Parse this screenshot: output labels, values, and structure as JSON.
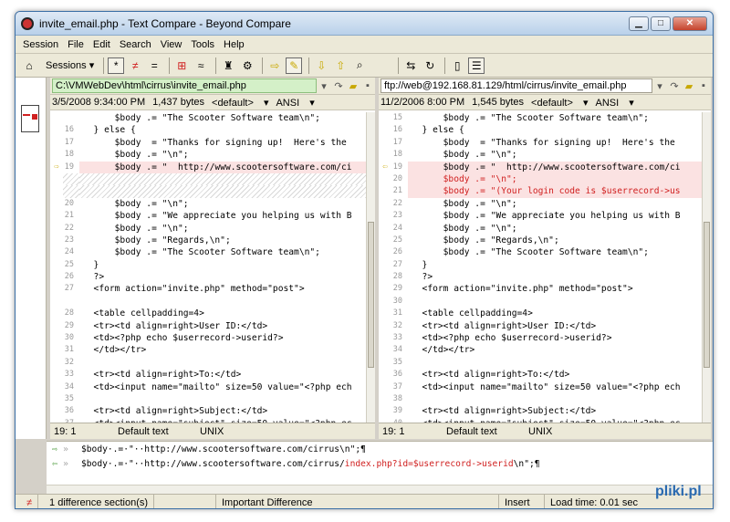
{
  "window": {
    "title": "invite_email.php - Text Compare - Beyond Compare"
  },
  "menu": [
    "Session",
    "File",
    "Edit",
    "Search",
    "View",
    "Tools",
    "Help"
  ],
  "toolbar": {
    "sessions_label": "Sessions"
  },
  "left": {
    "path": "C:\\VMWebDev\\html\\cirrus\\invite_email.php",
    "date": "3/5/2008 9:34:00 PM",
    "size": "1,437 bytes",
    "format": "<default>",
    "encoding": "ANSI",
    "position": "19: 1",
    "text_mode": "Default text",
    "line_end": "UNIX",
    "lines": [
      {
        "n": "",
        "t": "      $body .= \"The Scooter Software team\\n\";"
      },
      {
        "n": "16",
        "t": "  } else {"
      },
      {
        "n": "17",
        "t": "      $body  = \"Thanks for signing up!  Here's the"
      },
      {
        "n": "18",
        "t": "      $body .= \"\\n\";"
      },
      {
        "n": "19",
        "t": "      $body .= \"  http://www.scootersoftware.com/ci",
        "k": "diff",
        "m": "⇨"
      },
      {
        "n": "",
        "t": "",
        "k": "hatch"
      },
      {
        "n": "",
        "t": "",
        "k": "hatch"
      },
      {
        "n": "20",
        "t": "      $body .= \"\\n\";"
      },
      {
        "n": "21",
        "t": "      $body .= \"We appreciate you helping us with B"
      },
      {
        "n": "22",
        "t": "      $body .= \"\\n\";"
      },
      {
        "n": "23",
        "t": "      $body .= \"Regards,\\n\";"
      },
      {
        "n": "24",
        "t": "      $body .= \"The Scooter Software team\\n\";"
      },
      {
        "n": "25",
        "t": "  }"
      },
      {
        "n": "26",
        "t": "  ?>"
      },
      {
        "n": "27",
        "t": "  <form action=\"invite.php\" method=\"post\">"
      },
      {
        "n": "",
        "t": ""
      },
      {
        "n": "28",
        "t": "  <table cellpadding=4>"
      },
      {
        "n": "29",
        "t": "  <tr><td align=right>User ID:</td>"
      },
      {
        "n": "30",
        "t": "  <td><?php echo $userrecord->userid?>"
      },
      {
        "n": "31",
        "t": "  </td></tr>"
      },
      {
        "n": "32",
        "t": ""
      },
      {
        "n": "33",
        "t": "  <tr><td align=right>To:</td>"
      },
      {
        "n": "34",
        "t": "  <td><input name=\"mailto\" size=50 value=\"<?php ech"
      },
      {
        "n": "35",
        "t": ""
      },
      {
        "n": "36",
        "t": "  <tr><td align=right>Subject:</td>"
      },
      {
        "n": "37",
        "t": "  <td><input name=\"subject\" size=50 value=\"<?php ec"
      }
    ]
  },
  "right": {
    "path": "ftp://web@192.168.81.129/html/cirrus/invite_email.php",
    "date": "11/2/2006 8:00 PM",
    "size": "1,545 bytes",
    "format": "<default>",
    "encoding": "ANSI",
    "position": "19: 1",
    "text_mode": "Default text",
    "line_end": "UNIX",
    "lines": [
      {
        "n": "15",
        "t": "      $body .= \"The Scooter Software team\\n\";"
      },
      {
        "n": "16",
        "t": "  } else {"
      },
      {
        "n": "17",
        "t": "      $body  = \"Thanks for signing up!  Here's the"
      },
      {
        "n": "18",
        "t": "      $body .= \"\\n\";"
      },
      {
        "n": "19",
        "t": "      $body .= \"  http://www.scootersoftware.com/ci",
        "k": "diff",
        "m": "⇦"
      },
      {
        "n": "20",
        "t": "      $body .= \"\\n\";",
        "k": "diffr"
      },
      {
        "n": "21",
        "t": "      $body .= \"(Your login code is $userrecord->us",
        "k": "diffr"
      },
      {
        "n": "22",
        "t": "      $body .= \"\\n\";"
      },
      {
        "n": "23",
        "t": "      $body .= \"We appreciate you helping us with B"
      },
      {
        "n": "24",
        "t": "      $body .= \"\\n\";"
      },
      {
        "n": "25",
        "t": "      $body .= \"Regards,\\n\";"
      },
      {
        "n": "26",
        "t": "      $body .= \"The Scooter Software team\\n\";"
      },
      {
        "n": "27",
        "t": "  }"
      },
      {
        "n": "28",
        "t": "  ?>"
      },
      {
        "n": "29",
        "t": "  <form action=\"invite.php\" method=\"post\">"
      },
      {
        "n": "30",
        "t": ""
      },
      {
        "n": "31",
        "t": "  <table cellpadding=4>"
      },
      {
        "n": "32",
        "t": "  <tr><td align=right>User ID:</td>"
      },
      {
        "n": "33",
        "t": "  <td><?php echo $userrecord->userid?>"
      },
      {
        "n": "34",
        "t": "  </td></tr>"
      },
      {
        "n": "35",
        "t": ""
      },
      {
        "n": "36",
        "t": "  <tr><td align=right>To:</td>"
      },
      {
        "n": "37",
        "t": "  <td><input name=\"mailto\" size=50 value=\"<?php ech"
      },
      {
        "n": "38",
        "t": ""
      },
      {
        "n": "39",
        "t": "  <tr><td align=right>Subject:</td>"
      },
      {
        "n": "40",
        "t": "  <td><input name=\"subject\" size=50 value=\"<?php ec"
      }
    ]
  },
  "bottom": {
    "line1": "$body·.=·\"··http://www.scootersoftware.com/cirrus\\n\";¶",
    "line2a": "$body·.=·\"··http://www.scootersoftware.com/cirrus/",
    "line2b": "index.php?id=$userrecord->userid",
    "line2c": "\\n\";¶"
  },
  "status": {
    "diff_count": "1 difference section(s)",
    "importance": "Important Difference",
    "mode": "Insert",
    "load_time": "Load time: 0.01 sec"
  },
  "watermark": "pliki.pl"
}
